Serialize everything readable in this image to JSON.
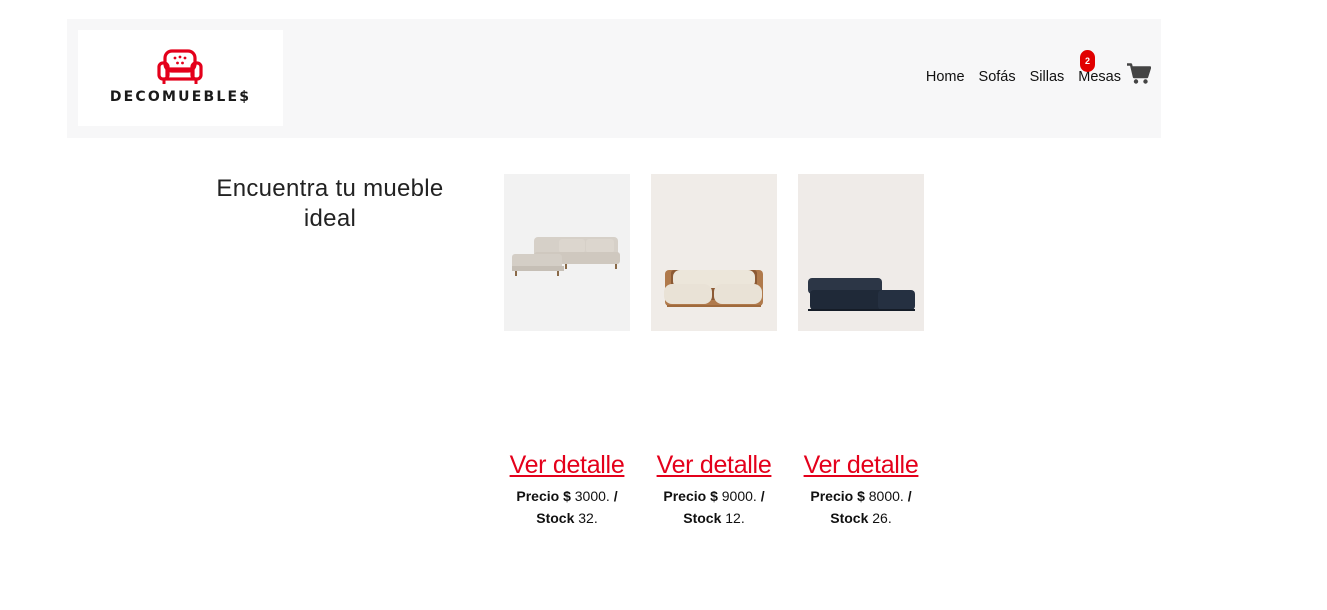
{
  "brand": {
    "logo_text": "DECOMUEBLE$"
  },
  "nav": {
    "items": [
      {
        "label": "Home"
      },
      {
        "label": "Sofás"
      },
      {
        "label": "Sillas"
      },
      {
        "label": "Mesas"
      }
    ],
    "cart_count": "2",
    "cart_icon": "shopping-cart-icon"
  },
  "hero": {
    "title": "Encuentra tu mueble ideal"
  },
  "products": [
    {
      "link_label": "Ver detalle",
      "price_label": "Precio $",
      "price": "3000.",
      "sep": "/",
      "stock_label": "Stock",
      "stock": "32.",
      "bg": "#f2f2f2"
    },
    {
      "link_label": "Ver detalle",
      "price_label": "Precio $",
      "price": "9000.",
      "sep": "/",
      "stock_label": "Stock",
      "stock": "12.",
      "bg": "#f0ece8"
    },
    {
      "link_label": "Ver detalle",
      "price_label": "Precio $",
      "price": "8000.",
      "sep": "/",
      "stock_label": "Stock",
      "stock": "26.",
      "bg": "#efebe8"
    }
  ],
  "colors": {
    "accent": "#e4001b",
    "navbar_bg": "#f7f7f8",
    "badge": "#e10000"
  }
}
